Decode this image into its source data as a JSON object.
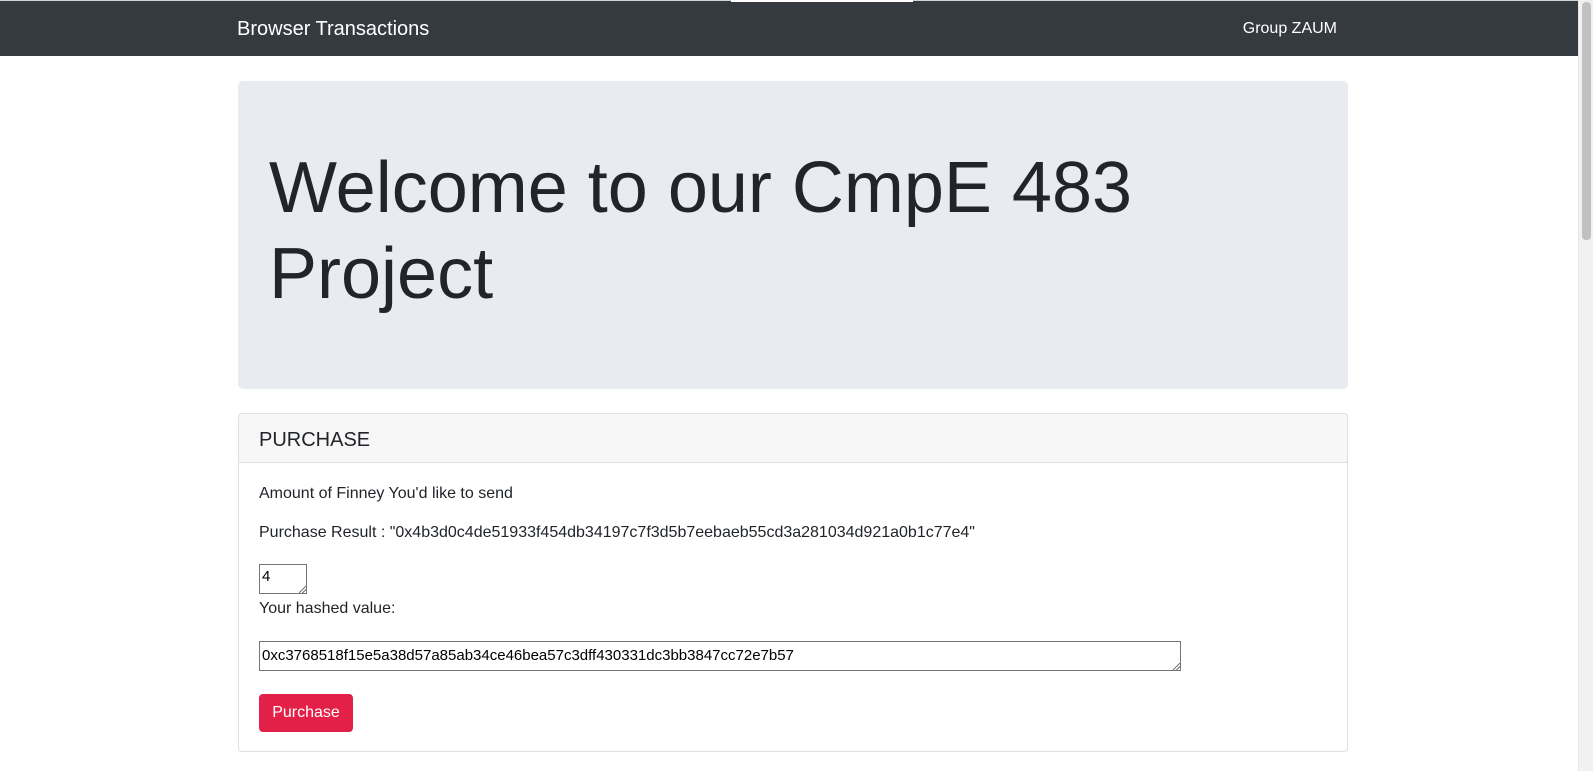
{
  "navbar": {
    "brand": "Browser Transactions",
    "right_label": "Group ZAUM"
  },
  "jumbotron": {
    "heading": "Welcome to our CmpE 483 Project"
  },
  "purchase_card": {
    "header": "PURCHASE",
    "amount_label": "Amount of Finney You'd like to send",
    "result_text": "Purchase Result : \"0x4b3d0c4de51933f454db34197c7f3d5b7eebaeb55cd3a281034d921a0b1c77e4\"",
    "amount_value": "4",
    "hashed_label": "Your hashed value:",
    "hashed_value": "0xc3768518f15e5a38d57a85ab34ce46bea57c3dff430331dc3bb3847cc72e7b57",
    "button_label": "Purchase"
  },
  "colors": {
    "navbar_bg": "#343a40",
    "jumbotron_bg": "#e8ebef",
    "button_bg": "#e32148"
  }
}
